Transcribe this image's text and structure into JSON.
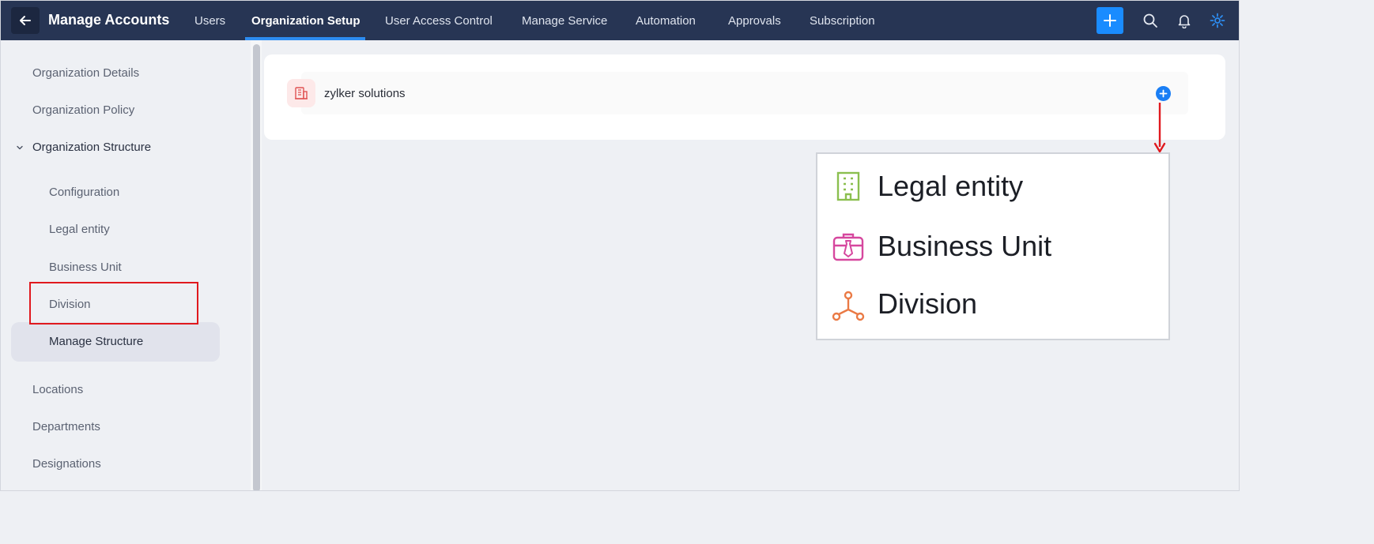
{
  "header": {
    "title": "Manage Accounts",
    "tabs": [
      {
        "label": "Users"
      },
      {
        "label": "Organization Setup",
        "active": true
      },
      {
        "label": "User Access Control"
      },
      {
        "label": "Manage Service"
      },
      {
        "label": "Automation"
      },
      {
        "label": "Approvals"
      },
      {
        "label": "Subscription"
      }
    ],
    "icons": [
      "back-arrow-icon",
      "plus-icon",
      "search-icon",
      "bell-icon",
      "gear-icon"
    ],
    "accent_color": "#2d8cf0",
    "bar_color": "#273554"
  },
  "sidebar": {
    "items": [
      {
        "label": "Organization Details"
      },
      {
        "label": "Organization Policy"
      },
      {
        "label": "Organization Structure",
        "expanded": true
      },
      {
        "label": "Configuration"
      },
      {
        "label": "Legal entity"
      },
      {
        "label": "Business Unit"
      },
      {
        "label": "Division"
      },
      {
        "label": "Manage Structure",
        "selected": true
      },
      {
        "label": "Locations"
      },
      {
        "label": "Departments"
      },
      {
        "label": "Designations"
      }
    ]
  },
  "main": {
    "org_name": "zylker solutions",
    "add_menu": {
      "items": [
        {
          "label": "Legal entity",
          "icon": "building-icon",
          "color": "#8bbf4f"
        },
        {
          "label": "Business Unit",
          "icon": "briefcase-icon",
          "color": "#d6479e"
        },
        {
          "label": "Division",
          "icon": "hierarchy-icon",
          "color": "#ea7a45"
        }
      ]
    },
    "highlight_color": "#e0191e"
  }
}
